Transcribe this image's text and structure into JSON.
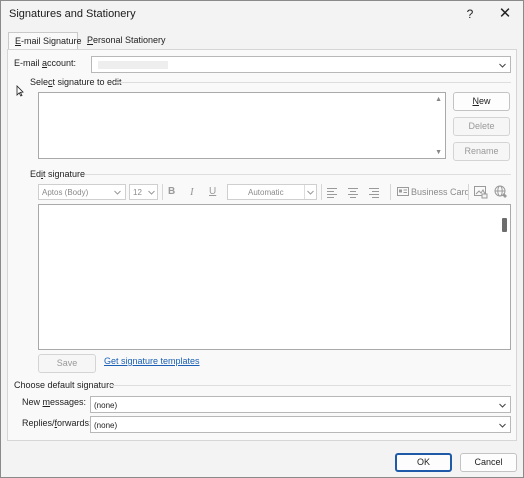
{
  "window": {
    "title": "Signatures and Stationery",
    "help_label": "?",
    "close_label": "✕"
  },
  "tabs": [
    {
      "prefix": "",
      "accel": "E",
      "rest": "-mail Signature",
      "active": true
    },
    {
      "prefix": "",
      "accel": "P",
      "rest": "ersonal Stationery",
      "active": false
    }
  ],
  "email_account": {
    "label_prefix": "E-mail ",
    "label_accel": "a",
    "label_rest": "ccount:",
    "value": ""
  },
  "select_signature": {
    "label_prefix": "Sele",
    "label_accel": "c",
    "label_rest": "t signature to edit",
    "items": [],
    "new_prefix": "",
    "new_accel": "N",
    "new_rest": "ew",
    "delete_label": "Delete",
    "rename_label": "Rename"
  },
  "edit_signature": {
    "label_prefix": "Ed",
    "label_accel": "i",
    "label_rest": "t signature",
    "font": "Aptos (Body)",
    "size": "12",
    "bold_glyph": "B",
    "italic_glyph": "I",
    "underline_glyph": "U",
    "color": "Automatic",
    "business_card_label": "Business Card",
    "save_label": "Save",
    "templates_link": "Get signature templates",
    "content": ""
  },
  "default_signature": {
    "heading": "Choose default signature",
    "new_messages_prefix": "New ",
    "new_messages_accel": "m",
    "new_messages_rest": "essages:",
    "new_messages_value": "(none)",
    "replies_prefix": "Replies/",
    "replies_accel": "f",
    "replies_rest": "orwards:",
    "replies_value": "(none)"
  },
  "footer": {
    "ok_label": "OK",
    "cancel_label": "Cancel"
  },
  "icons": {
    "dropdown": "chevron-down-icon",
    "scroll_up": "scroll-up-icon",
    "scroll_down": "scroll-down-icon",
    "business_card": "business-card-icon",
    "picture": "insert-picture-icon",
    "hyperlink": "hyperlink-icon"
  },
  "colors": {
    "accent": "#1f5aa8",
    "link": "#1a5fb4",
    "disabled": "#9a9a9a"
  }
}
